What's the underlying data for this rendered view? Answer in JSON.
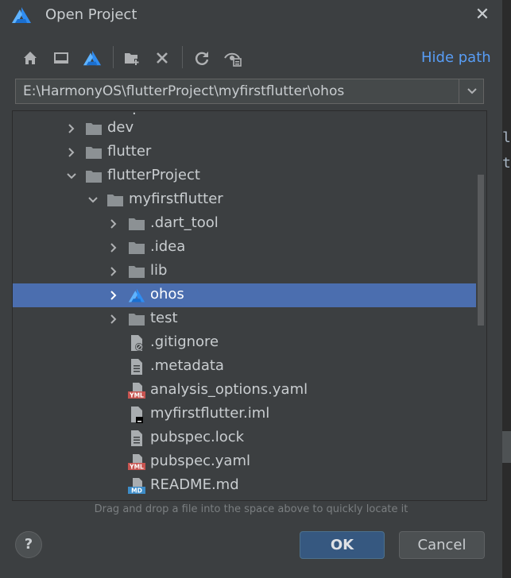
{
  "dialog": {
    "title": "Open Project",
    "close_label": "✕"
  },
  "toolbar": {
    "icons": [
      "home-icon",
      "desktop-icon",
      "project-logo-icon",
      "new-folder-icon",
      "delete-icon",
      "refresh-icon",
      "show-hidden-icon"
    ],
    "hide_path_label": "Hide path"
  },
  "path": {
    "value": "E:\\HarmonyOS\\flutterProject\\myfirstflutter\\ohos"
  },
  "tree": {
    "rows": [
      {
        "label": "dev",
        "level": 0,
        "type": "folder",
        "arrow": "collapsed"
      },
      {
        "label": "flutter",
        "level": 0,
        "type": "folder",
        "arrow": "collapsed"
      },
      {
        "label": "flutterProject",
        "level": 0,
        "type": "folder",
        "arrow": "expanded"
      },
      {
        "label": "myfirstflutter",
        "level": 1,
        "type": "folder",
        "arrow": "expanded"
      },
      {
        "label": ".dart_tool",
        "level": 2,
        "type": "folder",
        "arrow": "collapsed"
      },
      {
        "label": ".idea",
        "level": 2,
        "type": "folder",
        "arrow": "collapsed"
      },
      {
        "label": "lib",
        "level": 2,
        "type": "folder",
        "arrow": "collapsed"
      },
      {
        "label": "ohos",
        "level": 2,
        "type": "project",
        "arrow": "collapsed",
        "selected": true
      },
      {
        "label": "test",
        "level": 2,
        "type": "folder",
        "arrow": "collapsed"
      },
      {
        "label": ".gitignore",
        "level": 2,
        "type": "file-ignore",
        "arrow": "none"
      },
      {
        "label": ".metadata",
        "level": 2,
        "type": "file-text",
        "arrow": "none"
      },
      {
        "label": "analysis_options.yaml",
        "level": 2,
        "type": "file-yaml",
        "arrow": "none"
      },
      {
        "label": "myfirstflutter.iml",
        "level": 2,
        "type": "file-iml",
        "arrow": "none"
      },
      {
        "label": "pubspec.lock",
        "level": 2,
        "type": "file-text",
        "arrow": "none"
      },
      {
        "label": "pubspec.yaml",
        "level": 2,
        "type": "file-yaml",
        "arrow": "none"
      },
      {
        "label": "README.md",
        "level": 2,
        "type": "file-md",
        "arrow": "none"
      }
    ]
  },
  "hint_text": "Drag and drop a file into the space above to quickly locate it",
  "buttons": {
    "help_label": "?",
    "ok_label": "OK",
    "cancel_label": "Cancel"
  },
  "background_editor": {
    "chars": [
      "l",
      "t"
    ]
  },
  "colors": {
    "background": "#3c3f41",
    "selection": "#4b6eaf",
    "link": "#589df6",
    "ok_button": "#365880",
    "logo_blue": "#2f8cf0"
  }
}
